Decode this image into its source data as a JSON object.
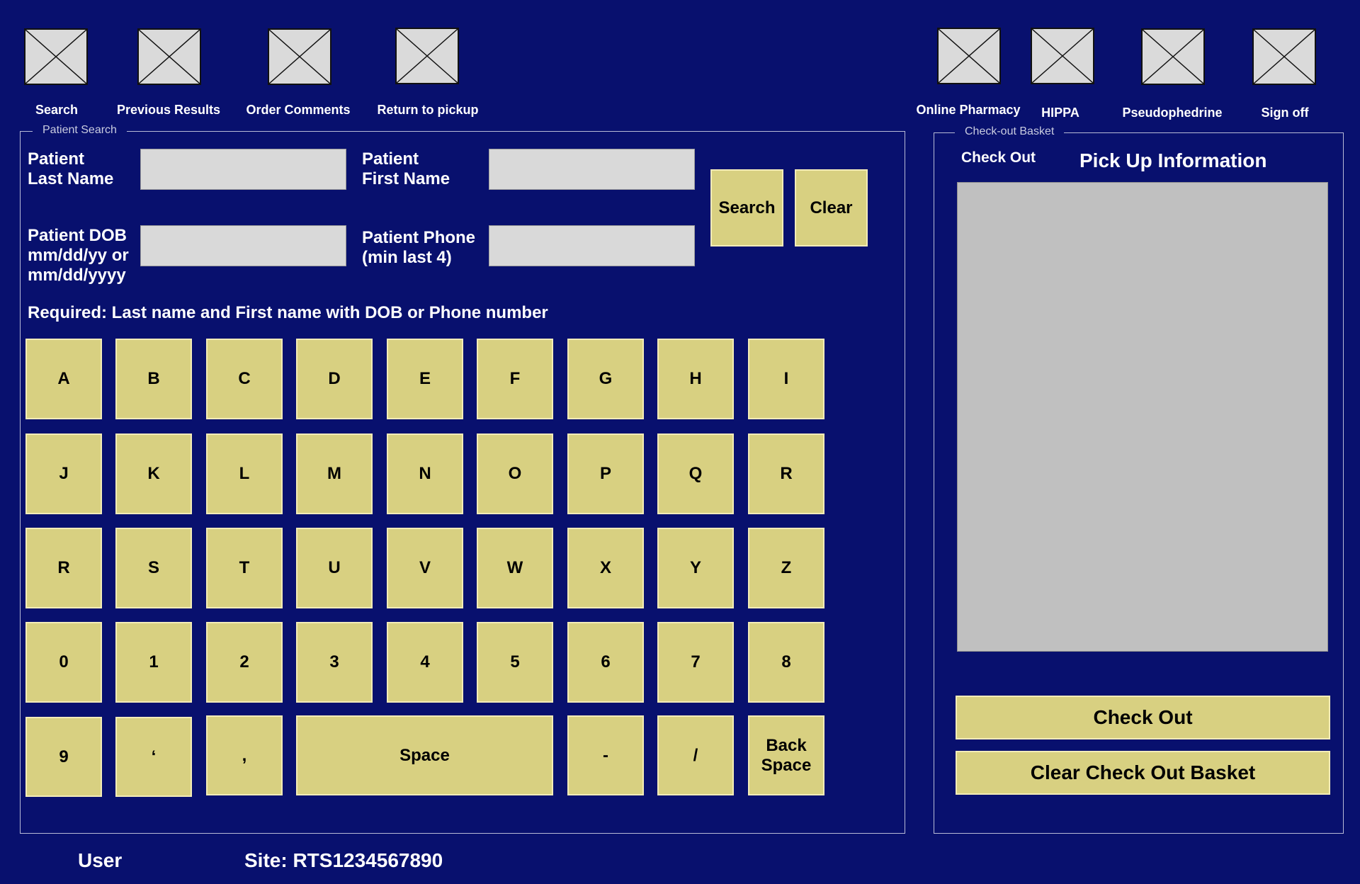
{
  "toolbar": {
    "left": [
      {
        "label": "Search",
        "icon": "placeholder-image-icon"
      },
      {
        "label": "Previous Results",
        "icon": "placeholder-image-icon"
      },
      {
        "label": "Order Comments",
        "icon": "placeholder-image-icon"
      },
      {
        "label": "Return to pickup",
        "icon": "placeholder-image-icon"
      }
    ],
    "right": [
      {
        "label": "Online Pharmacy",
        "icon": "placeholder-image-icon"
      },
      {
        "label": "HIPPA",
        "icon": "placeholder-image-icon"
      },
      {
        "label": "Pseudophedrine",
        "icon": "placeholder-image-icon"
      },
      {
        "label": "Sign off",
        "icon": "placeholder-image-icon"
      }
    ]
  },
  "patient_search": {
    "legend": "Patient Search",
    "last_name_label": "Patient\nLast Name",
    "last_name_value": "",
    "first_name_label": "Patient\nFirst Name",
    "first_name_value": "",
    "dob_label": "Patient DOB\nmm/dd/yy or\nmm/dd/yyyy",
    "dob_value": "",
    "phone_label": "Patient Phone\n(min last 4)",
    "phone_value": "",
    "search_button": "Search",
    "clear_button": "Clear",
    "required_note": "Required: Last name and First name with DOB or Phone number"
  },
  "keyboard": {
    "rows": [
      [
        "A",
        "B",
        "C",
        "D",
        "E",
        "F",
        "G",
        "H",
        "I"
      ],
      [
        "J",
        "K",
        "L",
        "M",
        "N",
        "O",
        "P",
        "Q",
        "R"
      ],
      [
        "R",
        "S",
        "T",
        "U",
        "V",
        "W",
        "X",
        "Y",
        "Z"
      ],
      [
        "0",
        "1",
        "2",
        "3",
        "4",
        "5",
        "6",
        "7",
        "8"
      ]
    ],
    "last_row": [
      "9",
      "‘",
      ",",
      "Space",
      "-",
      "/",
      "Back\nSpace"
    ]
  },
  "checkout_basket": {
    "legend": "Check-out Basket",
    "check_out_label": "Check Out",
    "title": "Pick Up Information",
    "check_out_button": "Check Out",
    "clear_button": "Clear Check Out Basket"
  },
  "footer": {
    "user": "User",
    "site": "Site: RTS1234567890"
  },
  "colors": {
    "background": "#08106e",
    "button": "#d8d081",
    "input": "#d9d9d9",
    "basket_area": "#c0c0c0"
  }
}
